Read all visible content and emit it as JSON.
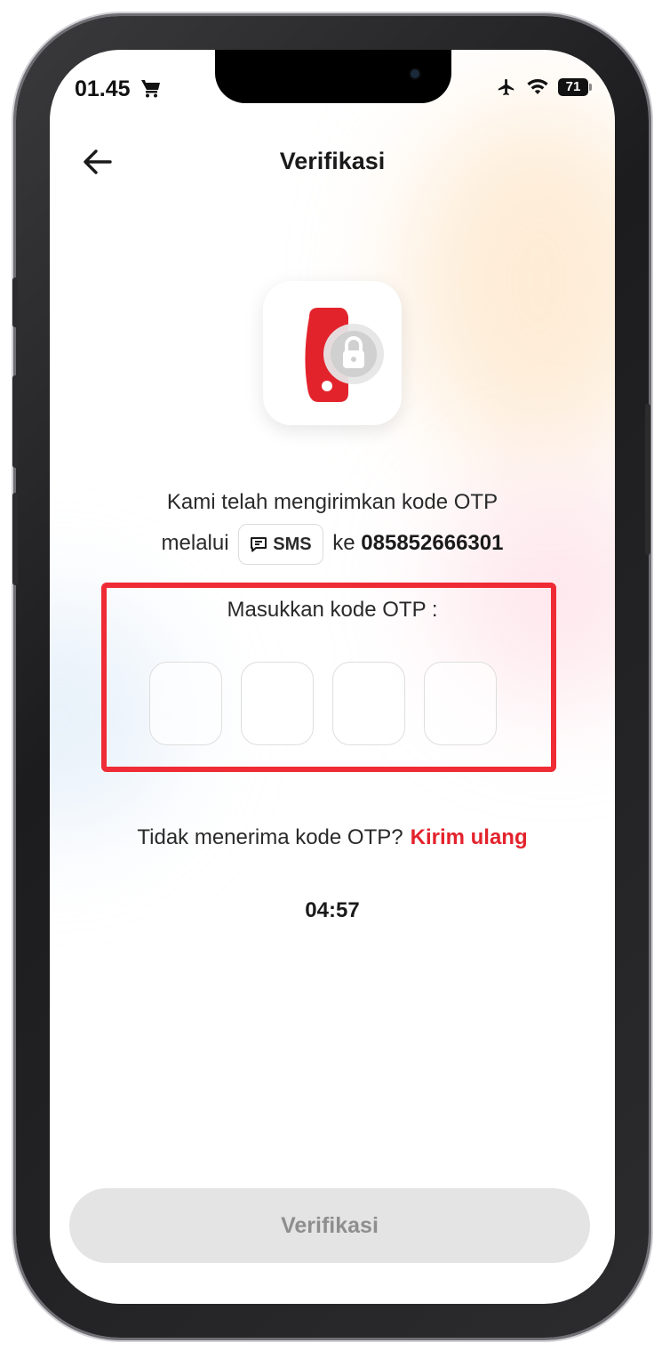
{
  "status_bar": {
    "time": "01.45",
    "battery": "71",
    "icons": [
      "cart-icon",
      "airplane-icon",
      "wifi-icon",
      "battery-icon"
    ]
  },
  "header": {
    "title": "Verifikasi"
  },
  "message": {
    "line1": "Kami telah mengirimkan kode OTP",
    "prefix": "melalui",
    "channel": "SMS",
    "to": "ke",
    "phone": "085852666301"
  },
  "otp": {
    "label": "Masukkan kode OTP :",
    "digits": [
      "",
      "",
      "",
      ""
    ]
  },
  "resend": {
    "text": "Tidak menerima kode OTP?",
    "link": "Kirim ulang"
  },
  "timer": "04:57",
  "footer": {
    "verify_label": "Verifikasi"
  },
  "colors": {
    "accent": "#e3232c",
    "highlight": "#ef2b35",
    "disabled_bg": "#e4e4e4",
    "disabled_text": "#8e8e8e"
  }
}
